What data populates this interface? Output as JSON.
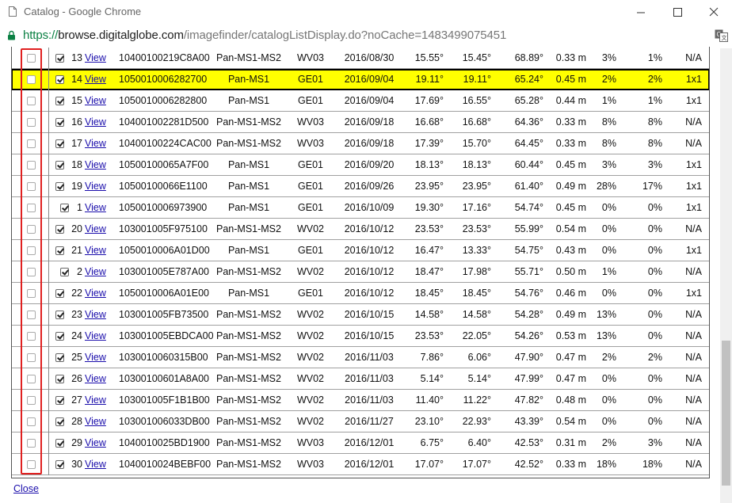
{
  "window": {
    "title": "Catalog - Google Chrome",
    "url_scheme": "https://",
    "url_host": "browse.digitalglobe.com",
    "url_path": "/imagefinder/catalogListDisplay.do?noCache=1483499075451"
  },
  "rows": [
    {
      "checked": true,
      "num": "13",
      "link": "View",
      "id": "10400100219C8A00",
      "bands": "Pan-MS1-MS2",
      "sensor": "WV03",
      "date": "2016/08/30",
      "a1": "15.55°",
      "a2": "15.45°",
      "a3": "68.89°",
      "res": "0.33 m",
      "p1": "3%",
      "p2": "1%",
      "pl": "N/A",
      "hl": false
    },
    {
      "checked": true,
      "num": "14",
      "link": "View",
      "id": "1050010006282700",
      "bands": "Pan-MS1",
      "sensor": "GE01",
      "date": "2016/09/04",
      "a1": "19.11°",
      "a2": "19.11°",
      "a3": "65.24°",
      "res": "0.45 m",
      "p1": "2%",
      "p2": "2%",
      "pl": "1x1",
      "hl": true
    },
    {
      "checked": true,
      "num": "15",
      "link": "View",
      "id": "1050010006282800",
      "bands": "Pan-MS1",
      "sensor": "GE01",
      "date": "2016/09/04",
      "a1": "17.69°",
      "a2": "16.55°",
      "a3": "65.28°",
      "res": "0.44 m",
      "p1": "1%",
      "p2": "1%",
      "pl": "1x1",
      "hl": false
    },
    {
      "checked": true,
      "num": "16",
      "link": "View",
      "id": "104001002281D500",
      "bands": "Pan-MS1-MS2",
      "sensor": "WV03",
      "date": "2016/09/18",
      "a1": "16.68°",
      "a2": "16.68°",
      "a3": "64.36°",
      "res": "0.33 m",
      "p1": "8%",
      "p2": "8%",
      "pl": "N/A",
      "hl": false
    },
    {
      "checked": true,
      "num": "17",
      "link": "View",
      "id": "10400100224CAC00",
      "bands": "Pan-MS1-MS2",
      "sensor": "WV03",
      "date": "2016/09/18",
      "a1": "17.39°",
      "a2": "15.70°",
      "a3": "64.45°",
      "res": "0.33 m",
      "p1": "8%",
      "p2": "8%",
      "pl": "N/A",
      "hl": false
    },
    {
      "checked": true,
      "num": "18",
      "link": "View",
      "id": "10500100065A7F00",
      "bands": "Pan-MS1",
      "sensor": "GE01",
      "date": "2016/09/20",
      "a1": "18.13°",
      "a2": "18.13°",
      "a3": "60.44°",
      "res": "0.45 m",
      "p1": "3%",
      "p2": "3%",
      "pl": "1x1",
      "hl": false
    },
    {
      "checked": true,
      "num": "19",
      "link": "View",
      "id": "10500100066E1100",
      "bands": "Pan-MS1",
      "sensor": "GE01",
      "date": "2016/09/26",
      "a1": "23.95°",
      "a2": "23.95°",
      "a3": "61.40°",
      "res": "0.49 m",
      "p1": "28%",
      "p2": "17%",
      "pl": "1x1",
      "hl": false
    },
    {
      "checked": true,
      "num": "1",
      "link": "View",
      "id": "1050010006973900",
      "bands": "Pan-MS1",
      "sensor": "GE01",
      "date": "2016/10/09",
      "a1": "19.30°",
      "a2": "17.16°",
      "a3": "54.74°",
      "res": "0.45 m",
      "p1": "0%",
      "p2": "0%",
      "pl": "1x1",
      "hl": false
    },
    {
      "checked": true,
      "num": "20",
      "link": "View",
      "id": "103001005F975100",
      "bands": "Pan-MS1-MS2",
      "sensor": "WV02",
      "date": "2016/10/12",
      "a1": "23.53°",
      "a2": "23.53°",
      "a3": "55.99°",
      "res": "0.54 m",
      "p1": "0%",
      "p2": "0%",
      "pl": "N/A",
      "hl": false
    },
    {
      "checked": true,
      "num": "21",
      "link": "View",
      "id": "1050010006A01D00",
      "bands": "Pan-MS1",
      "sensor": "GE01",
      "date": "2016/10/12",
      "a1": "16.47°",
      "a2": "13.33°",
      "a3": "54.75°",
      "res": "0.43 m",
      "p1": "0%",
      "p2": "0%",
      "pl": "1x1",
      "hl": false
    },
    {
      "checked": true,
      "num": "2",
      "link": "View",
      "id": "103001005E787A00",
      "bands": "Pan-MS1-MS2",
      "sensor": "WV02",
      "date": "2016/10/12",
      "a1": "18.47°",
      "a2": "17.98°",
      "a3": "55.71°",
      "res": "0.50 m",
      "p1": "1%",
      "p2": "0%",
      "pl": "N/A",
      "hl": false
    },
    {
      "checked": true,
      "num": "22",
      "link": "View",
      "id": "1050010006A01E00",
      "bands": "Pan-MS1",
      "sensor": "GE01",
      "date": "2016/10/12",
      "a1": "18.45°",
      "a2": "18.45°",
      "a3": "54.76°",
      "res": "0.46 m",
      "p1": "0%",
      "p2": "0%",
      "pl": "1x1",
      "hl": false
    },
    {
      "checked": true,
      "num": "23",
      "link": "View",
      "id": "103001005FB73500",
      "bands": "Pan-MS1-MS2",
      "sensor": "WV02",
      "date": "2016/10/15",
      "a1": "14.58°",
      "a2": "14.58°",
      "a3": "54.28°",
      "res": "0.49 m",
      "p1": "13%",
      "p2": "0%",
      "pl": "N/A",
      "hl": false
    },
    {
      "checked": true,
      "num": "24",
      "link": "View",
      "id": "103001005EBDCA00",
      "bands": "Pan-MS1-MS2",
      "sensor": "WV02",
      "date": "2016/10/15",
      "a1": "23.53°",
      "a2": "22.05°",
      "a3": "54.26°",
      "res": "0.53 m",
      "p1": "13%",
      "p2": "0%",
      "pl": "N/A",
      "hl": false
    },
    {
      "checked": true,
      "num": "25",
      "link": "View",
      "id": "1030010060315B00",
      "bands": "Pan-MS1-MS2",
      "sensor": "WV02",
      "date": "2016/11/03",
      "a1": "7.86°",
      "a2": "6.06°",
      "a3": "47.90°",
      "res": "0.47 m",
      "p1": "2%",
      "p2": "2%",
      "pl": "N/A",
      "hl": false
    },
    {
      "checked": true,
      "num": "26",
      "link": "View",
      "id": "10300100601A8A00",
      "bands": "Pan-MS1-MS2",
      "sensor": "WV02",
      "date": "2016/11/03",
      "a1": "5.14°",
      "a2": "5.14°",
      "a3": "47.99°",
      "res": "0.47 m",
      "p1": "0%",
      "p2": "0%",
      "pl": "N/A",
      "hl": false
    },
    {
      "checked": true,
      "num": "27",
      "link": "View",
      "id": "103001005F1B1B00",
      "bands": "Pan-MS1-MS2",
      "sensor": "WV02",
      "date": "2016/11/03",
      "a1": "11.40°",
      "a2": "11.22°",
      "a3": "47.82°",
      "res": "0.48 m",
      "p1": "0%",
      "p2": "0%",
      "pl": "N/A",
      "hl": false
    },
    {
      "checked": true,
      "num": "28",
      "link": "View",
      "id": "103001006033DB00",
      "bands": "Pan-MS1-MS2",
      "sensor": "WV02",
      "date": "2016/11/27",
      "a1": "23.10°",
      "a2": "22.93°",
      "a3": "43.39°",
      "res": "0.54 m",
      "p1": "0%",
      "p2": "0%",
      "pl": "N/A",
      "hl": false
    },
    {
      "checked": true,
      "num": "29",
      "link": "View",
      "id": "1040010025BD1900",
      "bands": "Pan-MS1-MS2",
      "sensor": "WV03",
      "date": "2016/12/01",
      "a1": "6.75°",
      "a2": "6.40°",
      "a3": "42.53°",
      "res": "0.31 m",
      "p1": "2%",
      "p2": "3%",
      "pl": "N/A",
      "hl": false
    },
    {
      "checked": true,
      "num": "30",
      "link": "View",
      "id": "1040010024BEBF00",
      "bands": "Pan-MS1-MS2",
      "sensor": "WV03",
      "date": "2016/12/01",
      "a1": "17.07°",
      "a2": "17.07°",
      "a3": "42.52°",
      "res": "0.33 m",
      "p1": "18%",
      "p2": "18%",
      "pl": "N/A",
      "hl": false
    }
  ],
  "footer": {
    "close_label": "Close"
  },
  "colors": {
    "highlight": "#ffff00",
    "annotation_box": "#e02020",
    "link": "#1a0dab"
  }
}
